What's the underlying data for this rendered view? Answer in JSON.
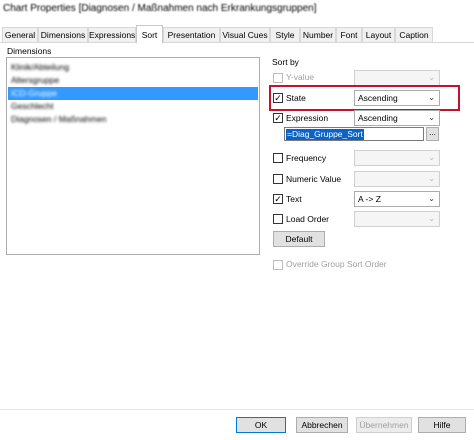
{
  "window": {
    "title": "Chart Properties [Diagnosen / Maßnahmen nach Erkrankungsgruppen]"
  },
  "tabs": [
    {
      "label": "General"
    },
    {
      "label": "Dimensions"
    },
    {
      "label": "Expressions"
    },
    {
      "label": "Sort"
    },
    {
      "label": "Presentation"
    },
    {
      "label": "Visual Cues"
    },
    {
      "label": "Style"
    },
    {
      "label": "Number"
    },
    {
      "label": "Font"
    },
    {
      "label": "Layout"
    },
    {
      "label": "Caption"
    }
  ],
  "active_tab": "Sort",
  "dimensions": {
    "label": "Dimensions",
    "items": [
      {
        "label": "Klinik/Abteilung"
      },
      {
        "label": "Altersgruppe"
      },
      {
        "label": "ICD-Gruppe"
      },
      {
        "label": "Geschlecht"
      },
      {
        "label": "Diagnosen / Maßnahmen"
      }
    ],
    "selected_index": 2
  },
  "sort_by": {
    "label": "Sort by",
    "y_value": {
      "label": "Y-value",
      "checked": false,
      "enabled": false,
      "value": ""
    },
    "state": {
      "label": "State",
      "checked": true,
      "enabled": true,
      "value": "Ascending"
    },
    "expression": {
      "label": "Expression",
      "checked": true,
      "enabled": true,
      "value": "Ascending",
      "formula": "=Diag_Gruppe_Sort",
      "browse_label": "..."
    },
    "frequency": {
      "label": "Frequency",
      "checked": false,
      "enabled": true,
      "value": ""
    },
    "numeric_value": {
      "label": "Numeric Value",
      "checked": false,
      "enabled": true,
      "value": ""
    },
    "text": {
      "label": "Text",
      "checked": true,
      "enabled": true,
      "value": "A -> Z"
    },
    "load_order": {
      "label": "Load Order",
      "checked": false,
      "enabled": true,
      "value": ""
    },
    "default_button": "Default"
  },
  "override_group_sort": {
    "label": "Override Group Sort Order",
    "checked": false,
    "enabled": false
  },
  "buttons": {
    "ok": "OK",
    "cancel": "Abbrechen",
    "apply": "Übernehmen",
    "help": "Hilfe"
  },
  "icons": {
    "dropdown": "chevron-down-icon",
    "checkmark": "check-icon"
  },
  "colors": {
    "selection": "#3399ff",
    "highlight_border": "#c8102e",
    "expression_selection": "#0a64c8"
  }
}
